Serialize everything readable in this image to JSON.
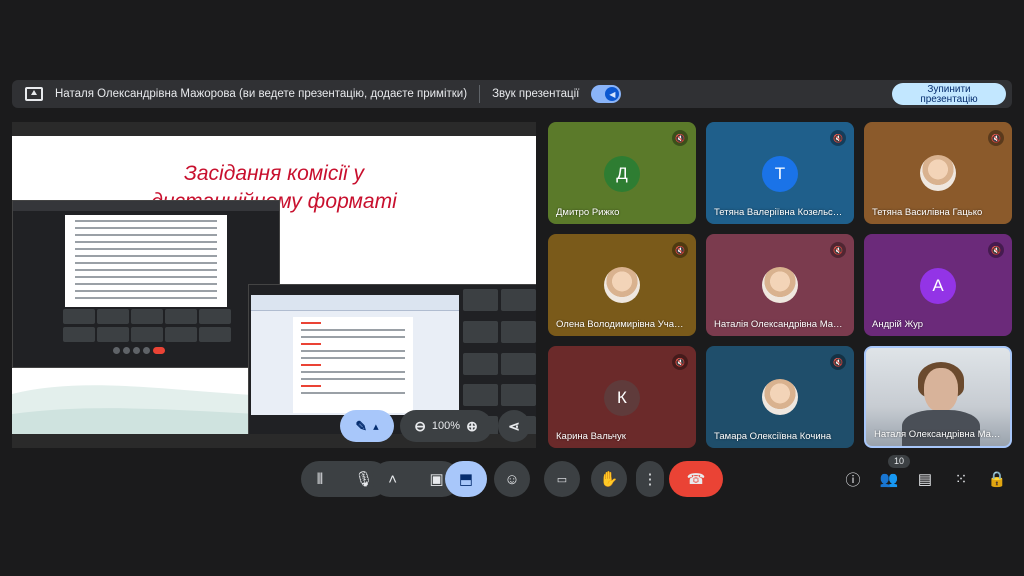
{
  "banner": {
    "presenting_text": "Наталя Олександрівна Мажорова (ви ведете презентацію, додаєте примітки)",
    "sound_label": "Звук презентації",
    "stop_button_label": "Зупинити\nпрезентацію"
  },
  "slide": {
    "title_line1": "Засідання комісії у",
    "title_line2": "дистанційному форматі"
  },
  "presentation_controls": {
    "zoom_level": "100%"
  },
  "participants": [
    {
      "name": "Дмитро Рижко",
      "initial": "Д",
      "tile_color": "#5b7a2a",
      "avatar_color": "#2e7d32"
    },
    {
      "name": "Тетяна Валеріївна Козельс…",
      "initial": "Т",
      "tile_color": "#1f5f8b",
      "avatar_color": "#1a73e8"
    },
    {
      "name": "Тетяна Василівна Гацько",
      "initial": "",
      "tile_color": "#8b5a2b",
      "avatar_color": ""
    },
    {
      "name": "Олена Володимирівна Уча…",
      "initial": "",
      "tile_color": "#7a5a1a",
      "avatar_color": ""
    },
    {
      "name": "Наталія Олександрівна Ма…",
      "initial": "",
      "tile_color": "#7b3b4e",
      "avatar_color": ""
    },
    {
      "name": "Андрій Жур",
      "initial": "А",
      "tile_color": "#6b2a7a",
      "avatar_color": "#9334e6"
    },
    {
      "name": "Карина Вальчук",
      "initial": "К",
      "tile_color": "#6b2a2a",
      "avatar_color": "#5f3b3b"
    },
    {
      "name": "Тамара Олексіївна Кочина",
      "initial": "",
      "tile_color": "#1f4e6b",
      "avatar_color": ""
    },
    {
      "name": "Наталя Олександрівна Ма…",
      "initial": "",
      "tile_color": "#cfd6dc",
      "avatar_color": ""
    }
  ],
  "toolbar": {
    "participant_count": "10"
  },
  "colors": {
    "accent": "#a8c7fa",
    "end_call": "#ea4335",
    "slide_title": "#c8102e"
  }
}
